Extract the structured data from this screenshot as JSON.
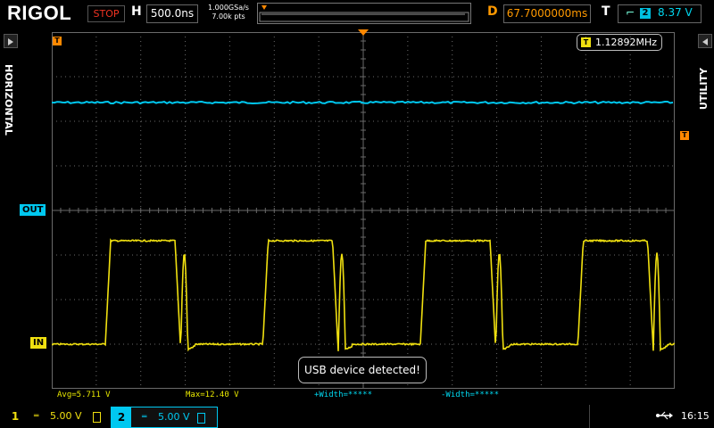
{
  "brand": "RIGOL",
  "status": "STOP",
  "horizontal": {
    "label": "H",
    "timebase": "500.0ns"
  },
  "acquisition": {
    "sample_rate": "1.000GSa/s",
    "memory_depth": "7.00k pts"
  },
  "delay": {
    "label": "D",
    "value": "67.7000000ms"
  },
  "trigger": {
    "label": "T",
    "edge_icon": "rising-edge-icon",
    "source": "2",
    "level": "8.37 V"
  },
  "side_tabs": {
    "left": "HORIZONTAL",
    "right": "UTILITY"
  },
  "markers": {
    "trigger_time": "T",
    "ch2_label": "OUT",
    "ch1_label": "IN",
    "trigger_level": "T"
  },
  "frequency_readout": {
    "icon": "T",
    "value": "1.12892MHz"
  },
  "toast": "USB device detected!",
  "measurements": [
    {
      "label": "Avg=5.711 V",
      "color": "#e8e800"
    },
    {
      "label": "Max=12.40 V",
      "color": "#e8e800"
    },
    {
      "label": "+Width=*****",
      "color": "#00d8f0"
    },
    {
      "label": "-Width=*****",
      "color": "#00d8f0"
    }
  ],
  "channels": [
    {
      "number": "1",
      "scale": "5.00 V",
      "coupling": "DC",
      "color": "#f0e010",
      "active": false
    },
    {
      "number": "2",
      "scale": "5.00 V",
      "coupling": "DC",
      "color": "#00c8f0",
      "active": true
    }
  ],
  "clock": "16:15",
  "colors": {
    "ch1": "#f0e010",
    "ch2": "#00c8f0",
    "trigger": "#ff8800",
    "stop": "#e03020",
    "grid": "#6a6a6a"
  },
  "icons": {
    "usb": "usb-icon",
    "coupling": "dc-coupling-icon",
    "invert": "channel-invert-icon"
  }
}
